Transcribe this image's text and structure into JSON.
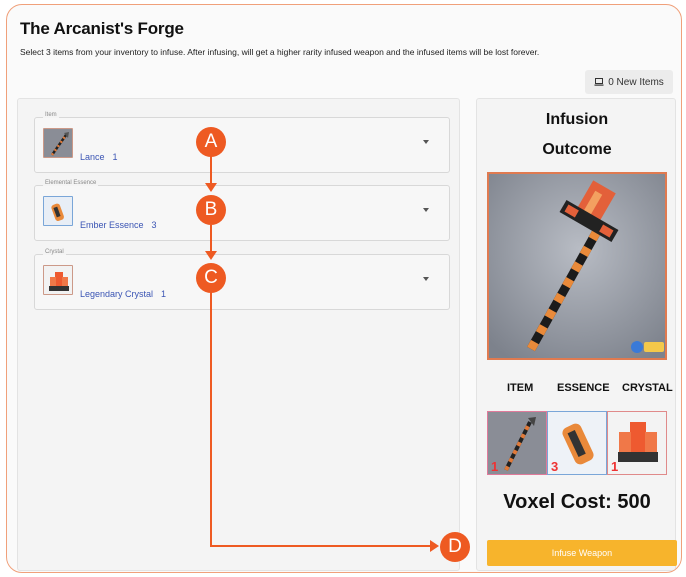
{
  "page": {
    "title": "The Arcanist's Forge",
    "subtitle": "Select 3 items from your inventory to infuse. After infusing, will get a higher rarity infused weapon and the infused items will be lost forever.",
    "new_items_label": "0 New Items"
  },
  "selects": [
    {
      "legend": "Item",
      "name": "Lance",
      "qty": "1"
    },
    {
      "legend": "Elemental Essence",
      "name": "Ember Essence",
      "qty": "3"
    },
    {
      "legend": "Crystal",
      "name": "Legendary Crystal",
      "qty": "1"
    }
  ],
  "outcome": {
    "title_line1": "Infusion",
    "title_line2": "Outcome",
    "columns": [
      "ITEM",
      "ESSENCE",
      "CRYSTAL"
    ],
    "counts": [
      "1",
      "3",
      "1"
    ],
    "voxel_cost": "Voxel Cost: 500",
    "button_label": "Infuse Weapon"
  },
  "annotations": [
    "A",
    "B",
    "C",
    "D"
  ],
  "colors": {
    "accent": "#ee5a22",
    "button": "#f7b42c",
    "link": "#3b55b4",
    "frame": "#f0a07a"
  }
}
